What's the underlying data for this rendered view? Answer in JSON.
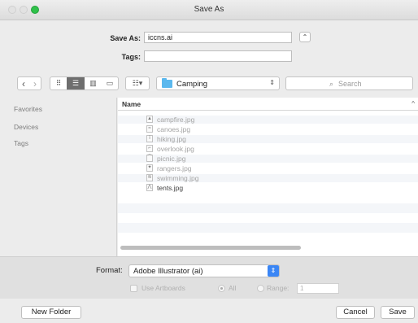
{
  "window": {
    "title": "Save As"
  },
  "form": {
    "save_as_label": "Save As:",
    "save_as_value": "iccns.ai",
    "tags_label": "Tags:",
    "tags_value": "",
    "collapse_glyph": "⌃"
  },
  "toolbar": {
    "back_glyph": "‹",
    "forward_glyph": "›",
    "view_icon_glyph": "⠿",
    "view_list_glyph": "☰",
    "view_column_glyph": "▥",
    "view_coverflow_glyph": "▭",
    "arrange_glyph": "☷▾",
    "path_folder": "Camping",
    "path_updown_glyph": "⇕",
    "search_placeholder": "Search",
    "search_glyph": "⌕"
  },
  "sidebar": {
    "items": [
      {
        "label": "Favorites"
      },
      {
        "label": "Devices"
      },
      {
        "label": "Tags"
      }
    ]
  },
  "filelist": {
    "column": "Name",
    "sort_glyph": "^",
    "files": [
      {
        "name": "campfire.jpg",
        "icon": "▲",
        "enabled": false
      },
      {
        "name": "canoes.jpg",
        "icon": "≈",
        "enabled": false
      },
      {
        "name": "hiking.jpg",
        "icon": "ǐ",
        "enabled": false
      },
      {
        "name": "overlook.jpg",
        "icon": "⌐",
        "enabled": false
      },
      {
        "name": "picnic.jpg",
        "icon": "⌒",
        "enabled": false
      },
      {
        "name": "rangers.jpg",
        "icon": "✦",
        "enabled": false
      },
      {
        "name": "swimming.jpg",
        "icon": "≋",
        "enabled": false
      },
      {
        "name": "tents.jpg",
        "icon": "⋀",
        "enabled": true
      }
    ]
  },
  "format": {
    "label": "Format:",
    "value": "Adobe Illustrator (ai)",
    "arrow_glyph": "⇕"
  },
  "options": {
    "use_artboards": "Use Artboards",
    "all": "All",
    "range": "Range:",
    "range_value": "1"
  },
  "buttons": {
    "new_folder": "New Folder",
    "cancel": "Cancel",
    "save": "Save"
  },
  "colors": {
    "accent": "#3a86f5",
    "folder": "#5bb8ee",
    "zoom_button": "#2fc14a"
  }
}
